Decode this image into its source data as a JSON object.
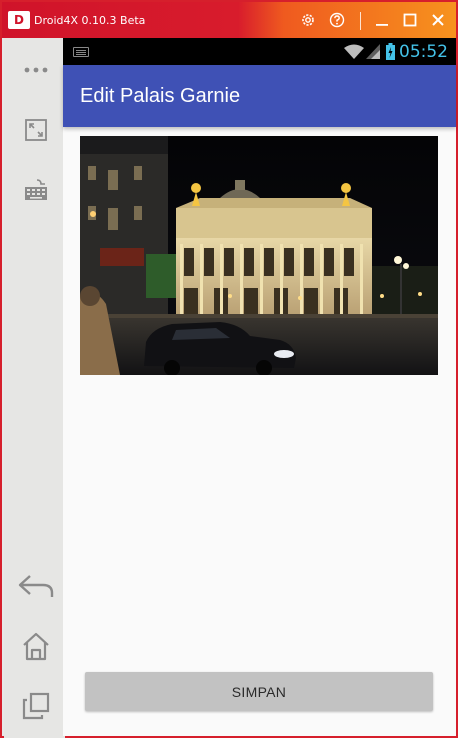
{
  "window": {
    "title": "Droid4X 0.10.3 Beta",
    "logo_text": "D",
    "buttons": {
      "settings": "settings-icon",
      "help": "help-icon",
      "minimize": "minimize-icon",
      "maximize": "maximize-icon",
      "close": "close-icon"
    }
  },
  "sidebar": {
    "items": [
      {
        "name": "more-icon"
      },
      {
        "name": "fullscreen-icon"
      },
      {
        "name": "keyboard-icon"
      },
      {
        "name": "back-icon"
      },
      {
        "name": "home-icon"
      },
      {
        "name": "recent-apps-icon"
      }
    ]
  },
  "status_bar": {
    "time": "05:52",
    "icons": [
      "keyboard-icon",
      "wifi-icon",
      "signal-icon",
      "battery-icon"
    ]
  },
  "app_bar": {
    "title": "Edit Palais Garnie"
  },
  "content": {
    "image_subject": "palais-garnier-night-photo"
  },
  "actions": {
    "save_label": "SIMPAN"
  },
  "colors": {
    "app_bar": "#3f51b5",
    "status_time": "#44c2e8",
    "button_bg": "#c2c2c2",
    "frame_border": "#d61f2c"
  }
}
